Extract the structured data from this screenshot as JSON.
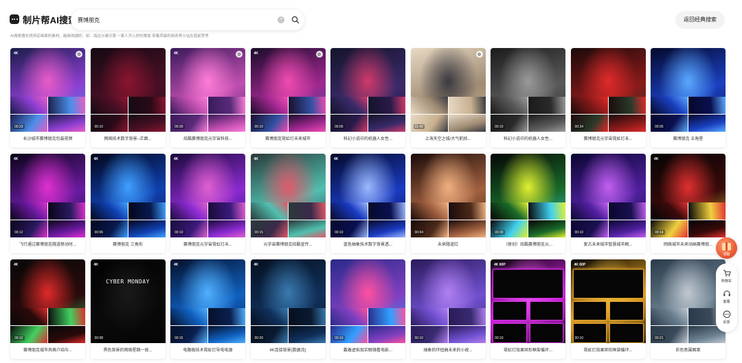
{
  "app": {
    "logo_text": "制片帮AI搜索",
    "search_value": "赛博朋克",
    "back_button": "返回经典搜索",
    "hint": "AI搜索擅长找特定画面的素材，越具体越好。如：海边沙滩日落 一家人开心的吃晚饭 穿着西装的商务男士站在窗前思考"
  },
  "side": {
    "gift_label": "领取",
    "items": [
      {
        "label": "购物车",
        "icon": "cart-icon"
      },
      {
        "label": "客服",
        "icon": "headset-icon"
      },
      {
        "label": "反馈",
        "icon": "chat-icon"
      }
    ]
  },
  "results": [
    {
      "caption": "长沙城市赛博朋克包装视频",
      "duration": "00:23",
      "badge": "4K",
      "fav": true,
      "colors": [
        "#1a1c4a",
        "#8c3fd1",
        "#e85cc8",
        "#4a8fe8"
      ]
    },
    {
      "caption": "网络技术数字背景--正面...",
      "duration": "00:10",
      "badge": "",
      "fav": false,
      "colors": [
        "#150a14",
        "#4a0f24",
        "#8a1530",
        "#2a0a18"
      ]
    },
    {
      "caption": "炫酷赛博朋克元宇宙科技...",
      "duration": "00:30",
      "badge": "4K",
      "fav": true,
      "colors": [
        "#3a1a5a",
        "#c04fb0",
        "#ff7cd8",
        "#5a2a7a"
      ]
    },
    {
      "caption": "赛博朋克霓虹灯未来城市",
      "duration": "00:10",
      "badge": "4K",
      "fav": true,
      "colors": [
        "#1a0c2a",
        "#a02890",
        "#f04cb0",
        "#3050a0"
      ]
    },
    {
      "caption": "科幻小说中的机器人女性...",
      "duration": "00:06",
      "badge": "",
      "fav": false,
      "colors": [
        "#14142a",
        "#3a2a6a",
        "#d03a6a",
        "#2a1a4a"
      ]
    },
    {
      "caption": "上海天空之城/大气航拍...",
      "duration": "01:42",
      "badge": "",
      "fav": true,
      "colors": [
        "#e8d9c4",
        "#a08c74",
        "#3a3a40",
        "#c8b090"
      ]
    },
    {
      "caption": "科幻小说中的机器人女性...",
      "duration": "00:10",
      "badge": "",
      "fav": false,
      "colors": [
        "#1a1a1a",
        "#5a5a5a",
        "#9a9a9a",
        "#2a2a2a"
      ]
    },
    {
      "caption": "赛博朋克元宇宙霓虹灯未...",
      "duration": "00:34",
      "badge": "",
      "fav": false,
      "colors": [
        "#1a0a0a",
        "#8a1a1a",
        "#e02a2a",
        "#2a3a2a"
      ]
    },
    {
      "caption": "赛博朋克 五角星",
      "duration": "00:05",
      "badge": "",
      "fav": false,
      "colors": [
        "#05082a",
        "#1a40c0",
        "#5aa8ff",
        "#0a1050"
      ]
    },
    {
      "caption": "飞行通过赛博朋克隧道移动时...",
      "duration": "00:12",
      "badge": "4K",
      "fav": false,
      "colors": [
        "#0a0418",
        "#6a1aa0",
        "#e030d0",
        "#2a1a60"
      ]
    },
    {
      "caption": "赛博朋克 三角形",
      "duration": "00:06",
      "badge": "4K",
      "fav": false,
      "colors": [
        "#02061a",
        "#1040b0",
        "#40a0ff",
        "#081a50"
      ]
    },
    {
      "caption": "赛博朋克元宇宙霓虹灯未...",
      "duration": "00:10",
      "badge": "4K",
      "fav": false,
      "colors": [
        "#1a0a3a",
        "#8a2ad0",
        "#e060d0",
        "#3a1a7a"
      ]
    },
    {
      "caption": "元宇宙赛博朋克炫酷宣传...",
      "duration": "00:15",
      "badge": "4K",
      "fav": false,
      "colors": [
        "#2a3a3a",
        "#50c0b0",
        "#e05a6a",
        "#3a2a4a"
      ]
    },
    {
      "caption": "蓝色抽象技术数字背景透...",
      "duration": "00:10",
      "badge": "4K",
      "fav": false,
      "colors": [
        "#040a2a",
        "#1a3ac0",
        "#9ab8ff",
        "#0a1050"
      ]
    },
    {
      "caption": "未来隧道红",
      "duration": "00:04",
      "badge": "",
      "fav": false,
      "colors": [
        "#1a0a08",
        "#a06040",
        "#f0b080",
        "#4a2a1a"
      ]
    },
    {
      "caption": "（原创）炫酷赛博朋克元...",
      "duration": "00:30",
      "badge": "",
      "fav": false,
      "colors": [
        "#050505",
        "#1a6a2a",
        "#e0f030",
        "#40d0f0"
      ]
    },
    {
      "caption": "复古未来城市智慧城市概...",
      "duration": "00:10",
      "badge": "",
      "fav": false,
      "colors": [
        "#0a0630",
        "#5020a0",
        "#c060f0",
        "#1a1050"
      ]
    },
    {
      "caption": "网络城市未来动画赛博朋...",
      "duration": "00:14",
      "badge": "4K",
      "fav": false,
      "colors": [
        "#050505",
        "#3a0a0a",
        "#e03030",
        "#f0d040"
      ]
    },
    {
      "caption": "赛博朋克城市风格介绍与...",
      "duration": "00:12",
      "badge": "4K",
      "fav": false,
      "colors": [
        "#080808",
        "#2a0a0a",
        "#e02a2a",
        "#40d060"
      ]
    },
    {
      "caption": "黑色背景的网络星期一故...",
      "duration": "00:08",
      "badge": "4K",
      "fav": false,
      "colors": [
        "#020202",
        "#0a0a0a",
        "#1a1a1a",
        "#050505"
      ],
      "overlay": "CYBER MONDAY"
    },
    {
      "caption": "电路板技术霓虹灯导电电源",
      "duration": "00:15",
      "badge": "4K",
      "fav": false,
      "colors": [
        "#04102a",
        "#1060c0",
        "#50b0ff",
        "#0a2050"
      ]
    },
    {
      "caption": "4K连接背景(数据流)",
      "duration": "00:20",
      "badge": "4K",
      "fav": false,
      "colors": [
        "#051020",
        "#10305a",
        "#3a7ab0",
        "#0a1a30"
      ]
    },
    {
      "caption": "戴着虚拟现实眼镜看电影...",
      "duration": "00:10",
      "badge": "",
      "fav": false,
      "colors": [
        "#2a2a8a",
        "#8040c0",
        "#ff50a0",
        "#30a0ff"
      ]
    },
    {
      "caption": "抽象的环扭曲未来的小故...",
      "duration": "00:10",
      "badge": "",
      "fav": false,
      "colors": [
        "#2a1a5a",
        "#7050d0",
        "#b080f0",
        "#3a2a70"
      ]
    },
    {
      "caption": "霓虹灯效果矩形框架循环...",
      "duration": "00:10",
      "badge": "4K 60P",
      "fav": false,
      "colors": [
        "#050505",
        "#d020e0",
        "#f060f0",
        "#100510"
      ],
      "frames": "#d030e0"
    },
    {
      "caption": "霓虹灯效果矩形框架循环...",
      "duration": "00:10",
      "badge": "4K 60P",
      "fav": false,
      "colors": [
        "#050505",
        "#e0a020",
        "#f0c040",
        "#100a02"
      ],
      "frames": "#e0a030"
    },
    {
      "caption": "彩色氛围图案",
      "duration": "00:21",
      "badge": "",
      "fav": false,
      "colors": [
        "#2a3a4a",
        "#6a8090",
        "#c0c8d0",
        "#3a4a5a"
      ]
    }
  ]
}
